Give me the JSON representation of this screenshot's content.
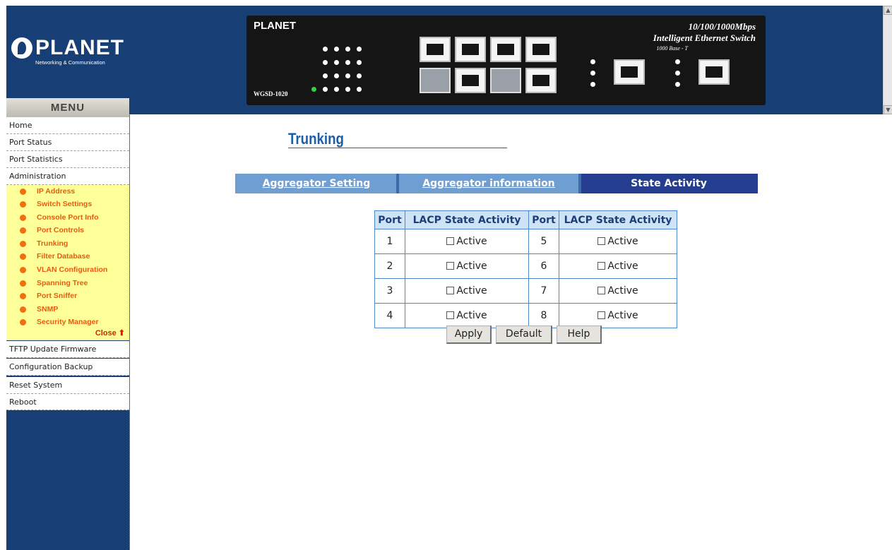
{
  "logo": {
    "brand": "PLANET",
    "tagline": "Networking & Communication"
  },
  "device": {
    "logo": "PLANET",
    "model": "WGSD-1020",
    "title1": "10/100/1000Mbps",
    "title2": "Intelligent Ethernet Switch",
    "subtitle": "1000 Base - T"
  },
  "sidebar": {
    "menu_title": "MENU",
    "items": [
      {
        "label": "Home"
      },
      {
        "label": "Port Status"
      },
      {
        "label": "Port Statistics"
      },
      {
        "label": "Administration"
      }
    ],
    "admin_subitems": [
      {
        "label": "IP Address"
      },
      {
        "label": "Switch Settings"
      },
      {
        "label": "Console Port Info"
      },
      {
        "label": "Port Controls"
      },
      {
        "label": "Trunking"
      },
      {
        "label": "Filter Database"
      },
      {
        "label": "VLAN Configuration"
      },
      {
        "label": "Spanning Tree"
      },
      {
        "label": "Port Sniffer"
      },
      {
        "label": "SNMP"
      },
      {
        "label": "Security Manager"
      }
    ],
    "close_label": "Close",
    "bottom_items": [
      {
        "label": "TFTP Update Firmware"
      },
      {
        "label": "Configuration Backup"
      },
      {
        "label": "Reset System"
      },
      {
        "label": "Reboot"
      }
    ]
  },
  "main": {
    "title": "Trunking",
    "tabs": [
      {
        "label": "Aggregator Setting"
      },
      {
        "label": "Aggregator information"
      },
      {
        "label": "State Activity",
        "active": true
      }
    ],
    "table": {
      "headers": [
        "Port",
        "LACP State Activity",
        "Port",
        "LACP State Activity"
      ],
      "rows": [
        {
          "port_a": "1",
          "state_a": "Active",
          "port_b": "5",
          "state_b": "Active"
        },
        {
          "port_a": "2",
          "state_a": "Active",
          "port_b": "6",
          "state_b": "Active"
        },
        {
          "port_a": "3",
          "state_a": "Active",
          "port_b": "7",
          "state_b": "Active"
        },
        {
          "port_a": "4",
          "state_a": "Active",
          "port_b": "8",
          "state_b": "Active"
        }
      ]
    },
    "buttons": {
      "apply": "Apply",
      "default": "Default",
      "help": "Help"
    }
  },
  "colors": {
    "sidebar_bg": "#183f75",
    "submenu_bg": "#ffff99",
    "submenu_text": "#e85a10",
    "tab_inactive": "#6f9ed2",
    "tab_active": "#253d8e",
    "title": "#1c5ea8",
    "table_header": "#cfe3f7"
  }
}
